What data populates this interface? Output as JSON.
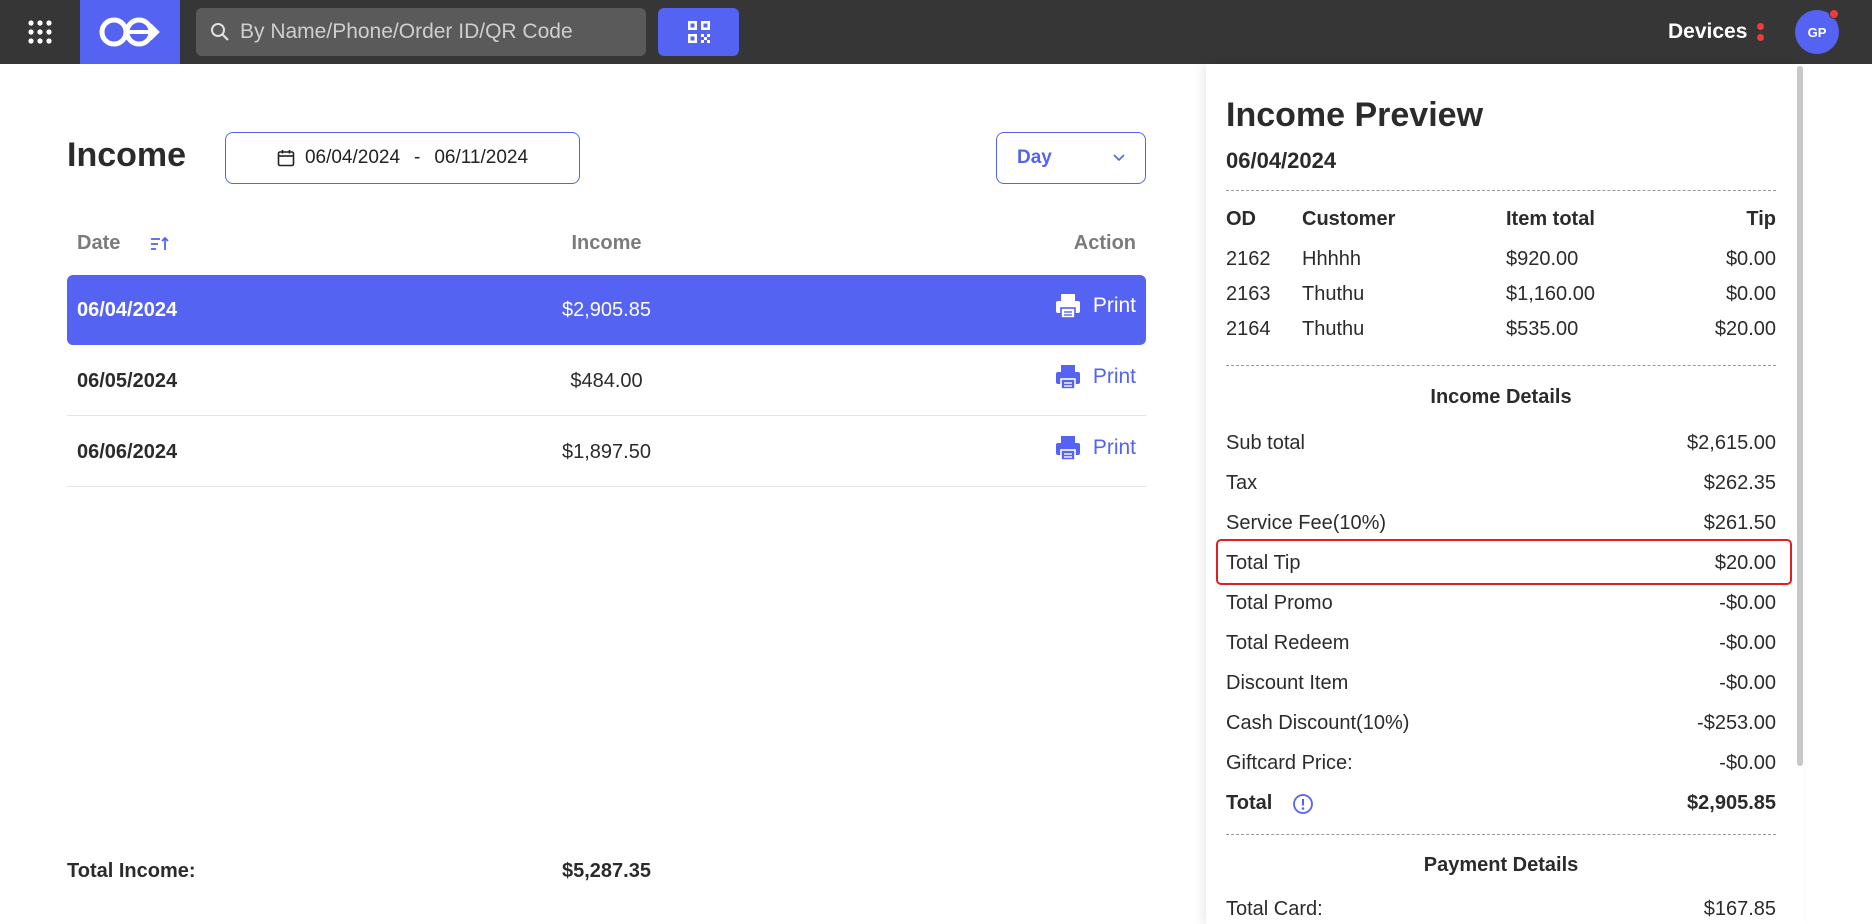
{
  "topbar": {
    "search_placeholder": "By Name/Phone/Order ID/QR Code",
    "devices_label": "Devices",
    "avatar_initials": "GP"
  },
  "income": {
    "title": "Income",
    "date_start": "06/04/2024",
    "date_sep": "-",
    "date_end": "06/11/2024",
    "period": "Day",
    "columns": {
      "date": "Date",
      "income": "Income",
      "action": "Action"
    },
    "rows": [
      {
        "date": "06/04/2024",
        "income": "$2,905.85",
        "action": "Print"
      },
      {
        "date": "06/05/2024",
        "income": "$484.00",
        "action": "Print"
      },
      {
        "date": "06/06/2024",
        "income": "$1,897.50",
        "action": "Print"
      }
    ],
    "total_label": "Total Income:",
    "total_value": "$5,287.35"
  },
  "preview": {
    "title": "Income Preview",
    "date": "06/04/2024",
    "order_columns": {
      "od": "OD",
      "customer": "Customer",
      "item_total": "Item total",
      "tip": "Tip"
    },
    "orders": [
      {
        "od": "2162",
        "customer": "Hhhhh",
        "item_total": "$920.00",
        "tip": "$0.00"
      },
      {
        "od": "2163",
        "customer": "Thuthu",
        "item_total": "$1,160.00",
        "tip": "$0.00"
      },
      {
        "od": "2164",
        "customer": "Thuthu",
        "item_total": "$535.00",
        "tip": "$20.00"
      }
    ],
    "income_details_title": "Income Details",
    "details": [
      {
        "label": "Sub total",
        "value": "$2,615.00"
      },
      {
        "label": "Tax",
        "value": "$262.35"
      },
      {
        "label": "Service Fee(10%)",
        "value": "$261.50"
      },
      {
        "label": "Total Tip",
        "value": "$20.00"
      },
      {
        "label": "Total Promo",
        "value": "-$0.00"
      },
      {
        "label": "Total Redeem",
        "value": "-$0.00"
      },
      {
        "label": "Discount Item",
        "value": "-$0.00"
      },
      {
        "label": "Cash Discount(10%)",
        "value": "-$253.00"
      },
      {
        "label": "Giftcard Price:",
        "value": "-$0.00"
      }
    ],
    "total_label": "Total",
    "total_value": "$2,905.85",
    "payment_details_title": "Payment Details",
    "payments": [
      {
        "label": "Total Card:",
        "value": "$167.85"
      }
    ]
  },
  "colors": {
    "accent": "#5463f2",
    "topbar": "#363636",
    "alert": "#ef3b3b",
    "highlight": "#e02020"
  }
}
